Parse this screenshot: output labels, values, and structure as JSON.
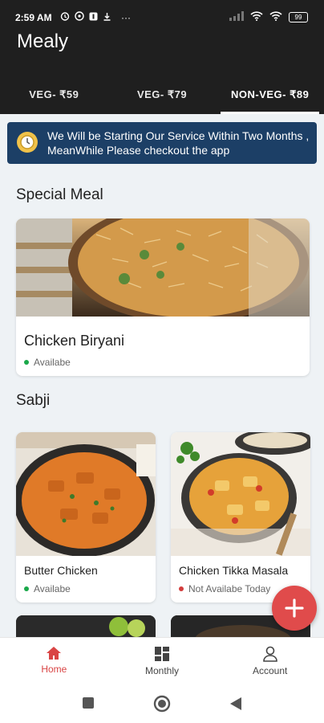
{
  "status_bar": {
    "time": "2:59 AM",
    "battery": "99",
    "more": "···"
  },
  "app": {
    "title": "Mealy"
  },
  "tabs": [
    {
      "label": "VEG- ₹59",
      "active": false
    },
    {
      "label": "VEG- ₹79",
      "active": false
    },
    {
      "label": "NON-VEG- ₹89",
      "active": true
    }
  ],
  "banner": {
    "icon": "clock-icon",
    "text": "We Will be Starting Our Service Within Two Months , MeanWhile Please checkout the app",
    "color": "#1c3f66"
  },
  "special_meal": {
    "title": "Special Meal",
    "item": {
      "name": "Chicken Biryani",
      "status": "Availabe",
      "status_color": "#1aa84a"
    }
  },
  "sabji": {
    "title": "Sabji",
    "items": [
      {
        "name": "Butter Chicken",
        "status": "Availabe",
        "status_color": "#1aa84a"
      },
      {
        "name": "Chicken Tikka Masala",
        "status": "Not Availabe Today",
        "status_color": "#d23c3c"
      }
    ]
  },
  "fab": {
    "icon": "plus-icon",
    "color": "#e04b4b"
  },
  "bottom_nav": [
    {
      "label": "Home",
      "icon": "home-icon",
      "active": true
    },
    {
      "label": "Monthly",
      "icon": "grid-icon",
      "active": false
    },
    {
      "label": "Account",
      "icon": "person-icon",
      "active": false
    }
  ],
  "colors": {
    "header": "#1f1f1f",
    "accent": "#d94444",
    "background": "#eef2f5"
  }
}
